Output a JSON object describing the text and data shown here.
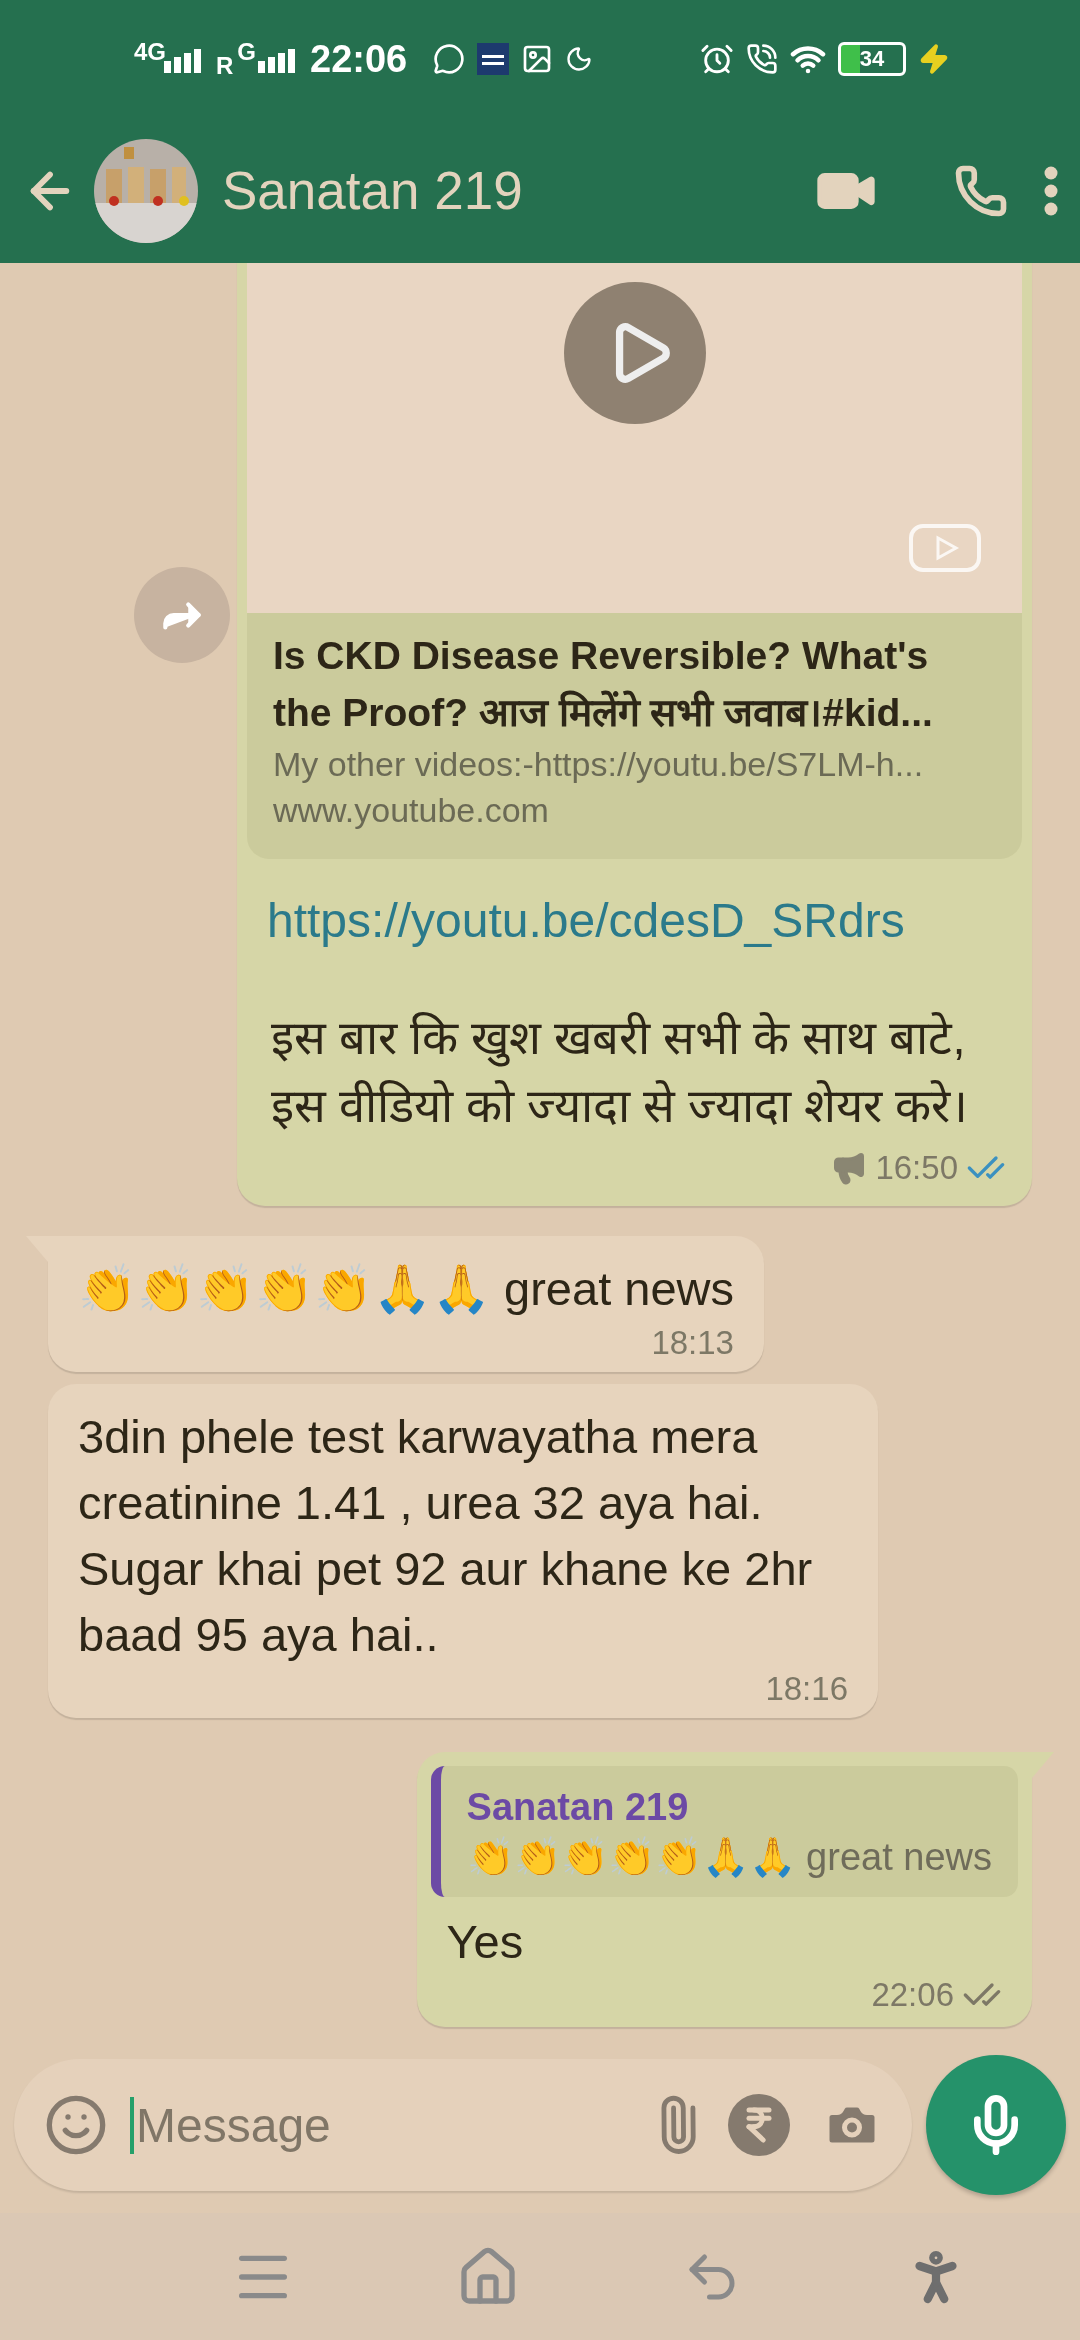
{
  "status_bar": {
    "network_1": "4G",
    "roaming": "R",
    "network_2": "G",
    "time": "22:06",
    "battery": "34"
  },
  "header": {
    "title": "Sanatan 219"
  },
  "messages": [
    {
      "kind": "link",
      "outgoing": true,
      "forwardable": true,
      "preview_title": "Is CKD Disease Reversible? What's the Proof? आज मिलेंगे सभी जवाब।#kid...",
      "preview_description": "My other videos:-https://youtu.be/S7LM-h...",
      "preview_domain": "www.youtube.com",
      "link": "https://youtu.be/cdesD_SRdrs",
      "text": "इस बार कि खुश खबरी सभी के साथ बाटे, इस वीडियो को ज्यादा से ज्यादा शेयर करे।",
      "time": "16:50",
      "read": true
    },
    {
      "kind": "text",
      "outgoing": false,
      "text": "👏👏👏👏👏🙏🙏 great news",
      "time": "18:13",
      "tail": true
    },
    {
      "kind": "text",
      "outgoing": false,
      "text": "3din phele test karwayatha mera creatinine 1.41 , urea 32 aya hai. Sugar khai pet 92 aur khane ke 2hr baad 95 aya hai..",
      "time": "18:16"
    },
    {
      "kind": "reply",
      "outgoing": true,
      "quoted_author": "Sanatan 219",
      "quoted_text": "👏👏👏👏👏🙏🙏 great news",
      "text": "Yes",
      "time": "22:06",
      "read": false
    }
  ],
  "composer": {
    "placeholder": "Message"
  }
}
